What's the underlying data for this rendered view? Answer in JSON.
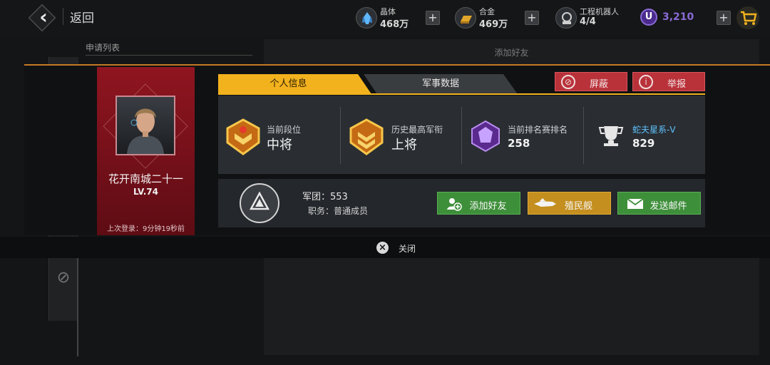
{
  "header": {
    "back_label": "返回",
    "resources": [
      {
        "name": "晶体",
        "value": "468万",
        "icon": "crystal-icon"
      },
      {
        "name": "合金",
        "value": "469万",
        "icon": "alloy-icon"
      },
      {
        "name": "工程机器人",
        "value": "4/4",
        "icon": "robot-icon"
      }
    ],
    "currency_value": "3,210",
    "currency_icon": "u-coin-icon"
  },
  "background": {
    "tab_label": "申请列表",
    "panel_title": "添加好友"
  },
  "profile": {
    "name": "花开南城二十一",
    "level": "LV.74",
    "last_login": "上次登录：9分钟19秒前"
  },
  "tabs": {
    "personal": "个人信息",
    "military": "军事数据"
  },
  "actions_top": {
    "block": "屏蔽",
    "report": "举报"
  },
  "stats": {
    "current_rank_label": "当前段位",
    "current_rank_value": "中将",
    "highest_title_label": "历史最高军衔",
    "highest_title_value": "上将",
    "ladder_label": "当前排名赛排名",
    "ladder_value": "258",
    "galaxy_label": "蛇夫星系-V",
    "galaxy_value": "829"
  },
  "legion": {
    "name_line": "军团：553",
    "role_line": "职务：普通成员"
  },
  "actions_bottom": {
    "add_friend": "添加好友",
    "colony_ship": "殖民舰",
    "send_mail": "发送邮件"
  },
  "close_label": "关闭",
  "colors": {
    "accent_yellow": "#f2b21e",
    "profile_red": "#8f1520",
    "btn_red": "#b9323a",
    "btn_green": "#3e8f3a",
    "btn_gold": "#c48f1e",
    "galaxy_blue": "#5fc3ff"
  }
}
